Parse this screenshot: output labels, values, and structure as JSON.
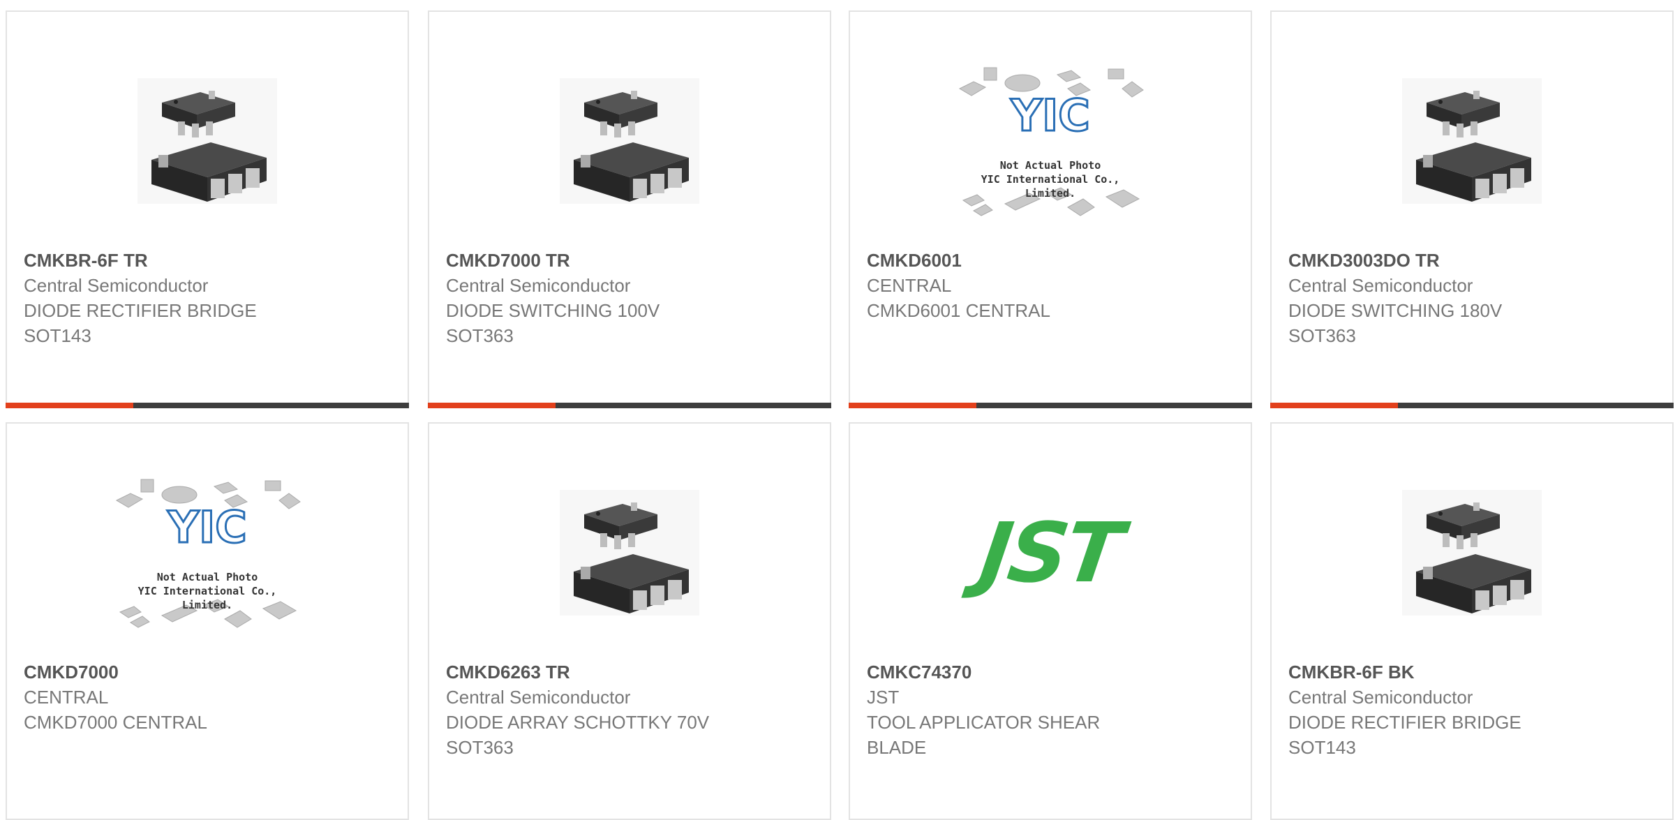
{
  "products": [
    {
      "part": "CMKBR-6F TR",
      "manufacturer": "Central Semiconductor",
      "lines": [
        "DIODE RECTIFIER BRIDGE",
        "SOT143"
      ],
      "image": "chip-package",
      "has_bar": true
    },
    {
      "part": "CMKD7000 TR",
      "manufacturer": "Central Semiconductor",
      "lines": [
        "DIODE SWITCHING 100V",
        "SOT363"
      ],
      "image": "chip-package",
      "has_bar": true
    },
    {
      "part": "CMKD6001",
      "manufacturer": "CENTRAL",
      "lines": [
        "CMKD6001 CENTRAL"
      ],
      "image": "placeholder-logo",
      "has_bar": true
    },
    {
      "part": "CMKD3003DO TR",
      "manufacturer": "Central Semiconductor",
      "lines": [
        "DIODE SWITCHING 180V",
        "SOT363"
      ],
      "image": "chip-package",
      "has_bar": true
    },
    {
      "part": "CMKD7000",
      "manufacturer": "CENTRAL",
      "lines": [
        "CMKD7000 CENTRAL"
      ],
      "image": "placeholder-logo",
      "has_bar": false
    },
    {
      "part": "CMKD6263 TR",
      "manufacturer": "Central Semiconductor",
      "lines": [
        "DIODE ARRAY SCHOTTKY 70V",
        "SOT363"
      ],
      "image": "chip-package",
      "has_bar": false
    },
    {
      "part": "CMKC74370",
      "manufacturer": "JST",
      "lines": [
        "TOOL APPLICATOR SHEAR",
        "BLADE"
      ],
      "image": "jst-logo",
      "has_bar": false
    },
    {
      "part": "CMKBR-6F BK",
      "manufacturer": "Central Semiconductor",
      "lines": [
        "DIODE RECTIFIER BRIDGE",
        "SOT143"
      ],
      "image": "chip-package",
      "has_bar": false
    }
  ],
  "placeholder": {
    "brand": "YIC",
    "caption1": "Not Actual Photo",
    "caption2": "YIC International Co., Limited."
  },
  "jst_logo_text": "JST",
  "colors": {
    "accent": "#e2401c",
    "bar_dark": "#3d3d3d",
    "card_border": "#e3e3e3",
    "jst_green": "#3aaf4a",
    "yic_blue": "#2a6fb5"
  }
}
